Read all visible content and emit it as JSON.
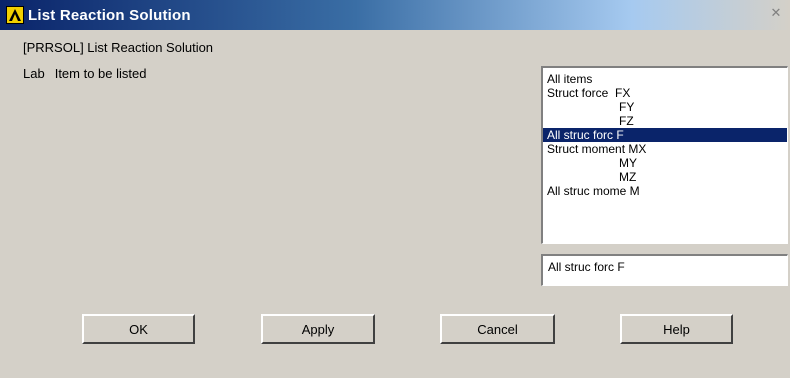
{
  "window": {
    "title": "List Reaction Solution",
    "command": "[PRRSOL]  List Reaction Solution"
  },
  "lab": {
    "key": "Lab",
    "description": "Item to be listed"
  },
  "listbox": {
    "items": [
      "All items",
      "Struct force  FX",
      "FY",
      "FZ",
      "All struc forc F",
      "Struct moment MX",
      "MY",
      "MZ",
      "All struc mome M"
    ],
    "selected": "All struc forc F"
  },
  "selection_field": {
    "value": "All struc forc F"
  },
  "buttons": {
    "ok": "OK",
    "apply": "Apply",
    "cancel": "Cancel",
    "help": "Help"
  },
  "colors": {
    "selection_bg": "#0a246a",
    "window_bg": "#d4d0c8"
  }
}
